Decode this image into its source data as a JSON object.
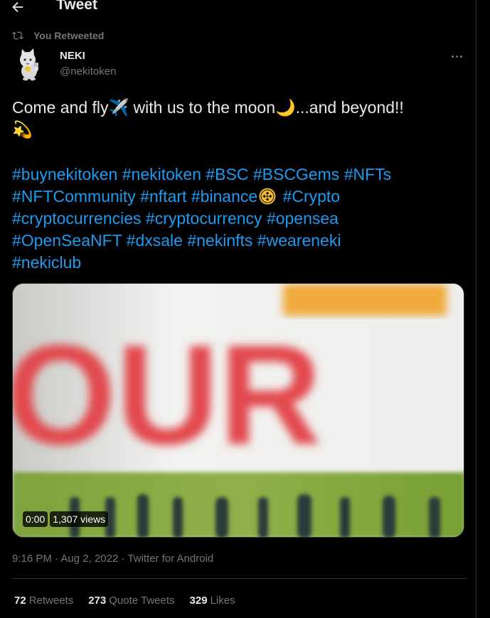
{
  "header": {
    "title": "Tweet"
  },
  "retweet": {
    "text": "You Retweeted"
  },
  "author": {
    "name": "NEKI",
    "handle": "@nekitoken"
  },
  "tweet": {
    "line1_a": "Come and fly",
    "emoji_plane": "✈️",
    "line1_b": " with us to the moon",
    "emoji_moon": "🌙",
    "line1_c": "...and beyond!!",
    "emoji_star": "💫",
    "hashtags": [
      "#buynekitoken",
      "#nekitoken",
      "#BSC",
      "#BSCGems",
      "#NFTs",
      "#NFTCommunity",
      "#nftart",
      "#binance",
      "#Crypto",
      "#cryptocurrencies",
      "#cryptocurrency",
      "#opensea",
      "#OpenSeaNFT",
      "#dxsale",
      "#nekinfts",
      "#weareneki",
      "#nekiclub"
    ]
  },
  "media": {
    "type": "video",
    "timestamp": "0:00",
    "views": "1,307 views",
    "frame_text": "OUR"
  },
  "meta": {
    "time": "9:16 PM",
    "separator": " · ",
    "date": "Aug 2, 2022",
    "source": "Twitter for Android"
  },
  "stats": {
    "retweets": {
      "count": "72",
      "label": "Retweets"
    },
    "quotes": {
      "count": "273",
      "label": "Quote Tweets"
    },
    "likes": {
      "count": "329",
      "label": "Likes"
    }
  },
  "colors": {
    "background": "#000000",
    "text": "#e7e9ea",
    "secondary": "#71767b",
    "link": "#1d9bf0",
    "border": "#2f3336"
  }
}
